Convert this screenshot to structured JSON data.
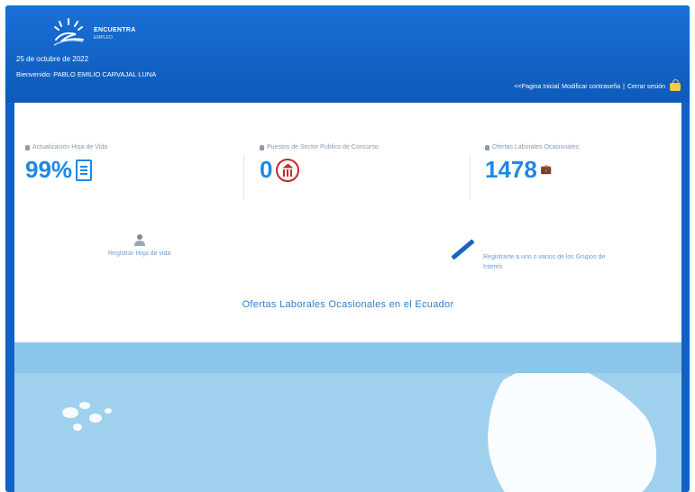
{
  "brand": {
    "name": "ENCUENTRA",
    "sub": "EMPLEO"
  },
  "header": {
    "date": "25 de octubre de 2022",
    "user_line": "Bienvenido: PABLO EMILIO CARVAJAL LUNA",
    "links": [
      "<<Pagina Inicial",
      "Modificar contraseña",
      "Cerrar sesión"
    ],
    "separators": [
      "|"
    ]
  },
  "stats": [
    {
      "label": "Actualización Hoja de Vida",
      "value": "99%",
      "icon": "document-icon"
    },
    {
      "label": "Puestos de Sector Público de Concurso",
      "value": "0",
      "icon": "bank-icon"
    },
    {
      "label": "Ofertas Laborales Ocasionales",
      "value": "1478",
      "extra": "",
      "icon": "briefcase-icon"
    }
  ],
  "actions": {
    "left_label": "Registrar Hoja de vida",
    "right_label": "Registrarte a uno o varios de los Grupos de Interés"
  },
  "section_title": "Ofertas Laborales Ocasionales en el Ecuador",
  "colors": {
    "primary": "#1262c6",
    "accent": "#1e88e5",
    "bank": "#c62828",
    "map_water": "#9fd0ee"
  }
}
